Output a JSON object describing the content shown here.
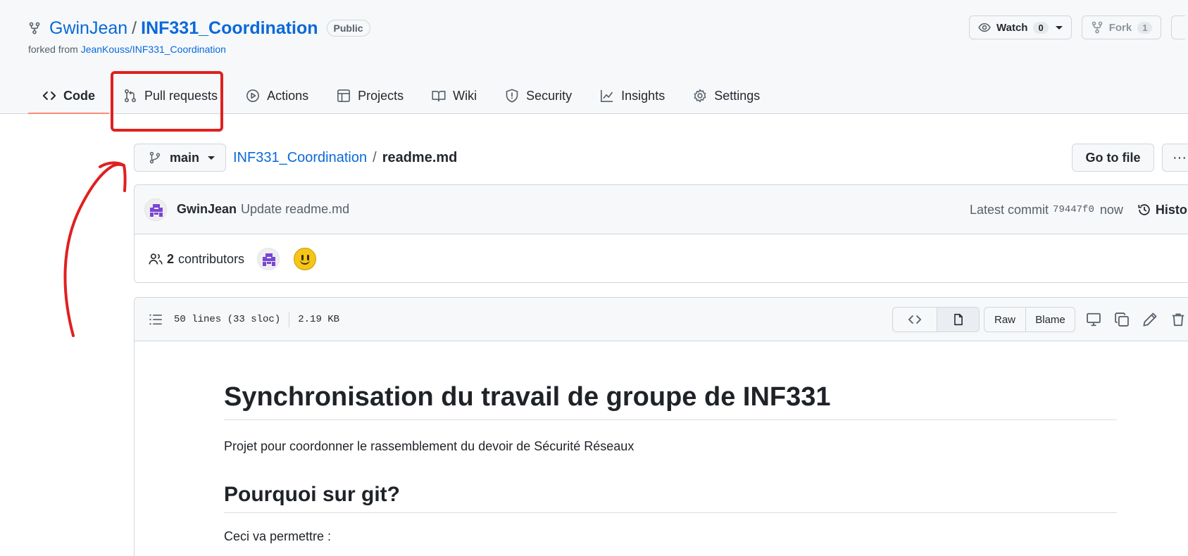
{
  "repo": {
    "owner": "GwinJean",
    "separator": "/",
    "name": "INF331_Coordination",
    "visibility": "Public",
    "forked_prefix": "forked from",
    "forked_source": "JeanKouss/INF331_Coordination"
  },
  "header_actions": {
    "watch_label": "Watch",
    "watch_count": "0",
    "fork_label": "Fork",
    "fork_count": "1"
  },
  "tabs": [
    {
      "label": "Code",
      "icon": "code-icon",
      "active": true
    },
    {
      "label": "Pull requests",
      "icon": "git-pull-request-icon"
    },
    {
      "label": "Actions",
      "icon": "play-icon"
    },
    {
      "label": "Projects",
      "icon": "table-icon"
    },
    {
      "label": "Wiki",
      "icon": "book-icon"
    },
    {
      "label": "Security",
      "icon": "shield-icon"
    },
    {
      "label": "Insights",
      "icon": "graph-icon"
    },
    {
      "label": "Settings",
      "icon": "gear-icon"
    }
  ],
  "file_nav": {
    "branch": "main",
    "breadcrumb_repo": "INF331_Coordination",
    "breadcrumb_sep": "/",
    "breadcrumb_file": "readme.md",
    "go_to_file": "Go to file",
    "more": "···"
  },
  "commit": {
    "author": "GwinJean",
    "message": "Update readme.md",
    "latest_label": "Latest commit",
    "sha": "79447f0",
    "time": "now",
    "history_label": "History"
  },
  "contributors": {
    "count": "2",
    "label": "contributors"
  },
  "file_info": {
    "lines": "50 lines (33 sloc)",
    "size": "2.19 KB",
    "raw": "Raw",
    "blame": "Blame"
  },
  "readme": {
    "h1": "Synchronisation du travail de groupe de INF331",
    "p1": "Projet pour coordonner le rassemblement du devoir de Sécurité Réseaux",
    "h2": "Pourquoi sur git?",
    "p2": "Ceci va permettre :"
  },
  "colors": {
    "link": "#0969da",
    "annotation": "#e02020",
    "active_tab_underline": "#fd8c73"
  }
}
